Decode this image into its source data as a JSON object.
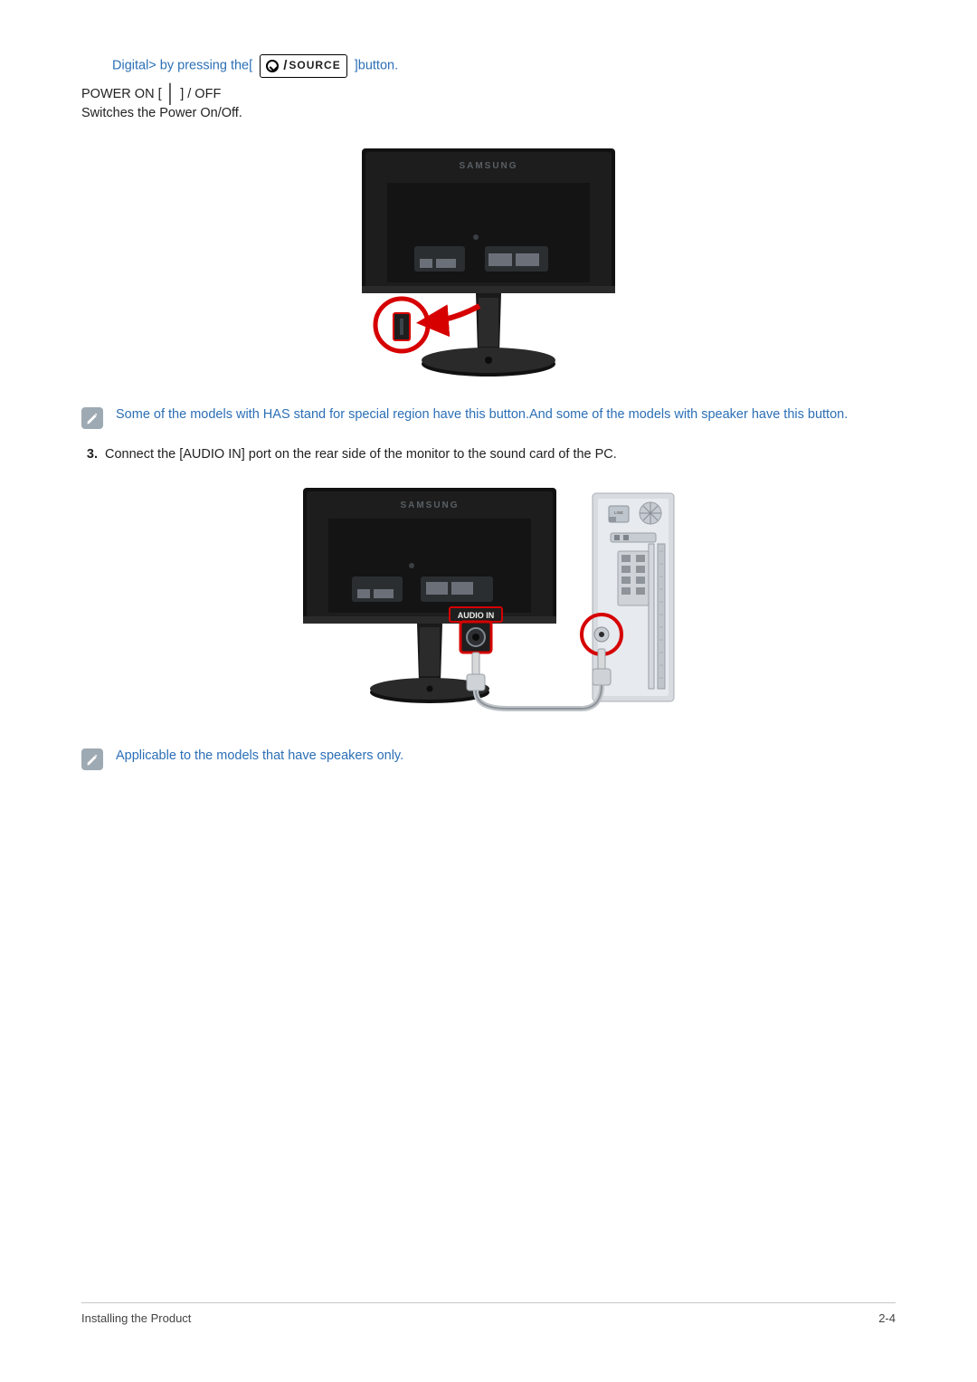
{
  "top": {
    "prefix": "Digital> by pressing the[",
    "source_label": "SOURCE",
    "suffix": "]button."
  },
  "power": {
    "heading_before": "POWER ON [",
    "heading_sep": "│",
    "heading_after": "] / OFF",
    "desc": "Switches the Power On/Off."
  },
  "note1": "Some of the models with HAS stand for special region  have this button.And some of the models with speaker have this button.",
  "step3": {
    "number": "3.",
    "text": "Connect the [AUDIO IN] port on the rear side of the monitor to the sound card of the PC."
  },
  "fig2": {
    "audio_label": "AUDIO IN",
    "brand": "SAMSUNG",
    "rear_top": "LINE"
  },
  "note2": "Applicable to the models that have speakers only.",
  "footer": {
    "left": "Installing the Product",
    "right": "2-4"
  },
  "brand_fig1": "SAMSUNG"
}
